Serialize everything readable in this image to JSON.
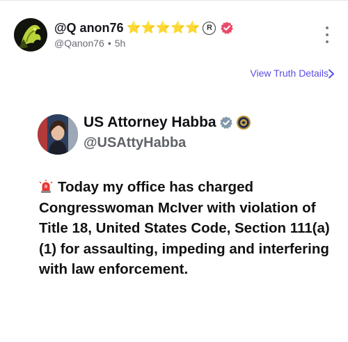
{
  "post": {
    "display_name": "@Q anon76",
    "badges": "⭐⭐⭐⭐⭐",
    "reg_mark": "R",
    "handle": "@Qanon76",
    "time": "5h",
    "view_details_label": "View Truth Details"
  },
  "embedded": {
    "name": "US Attorney Habba",
    "handle": "@USAttyHabba",
    "text": "Today my office has charged Congresswoman McIver with violation of Title 18, United States Code, Section 111(a)(1) for assaulting, impeding and interfering with law enforcement."
  },
  "colors": {
    "accent": "#5b4ee6",
    "verified_pink": "#e84c6b",
    "star": "#f5c518",
    "siren": "#e53935"
  },
  "icons": {
    "verified": "pink-verified-badge-icon",
    "more": "vertical-ellipsis-icon",
    "chevron": "chevron-right-icon",
    "gray_check": "gray-verified-badge-icon",
    "doj_seal": "doj-seal-icon",
    "siren": "police-siren-icon"
  }
}
